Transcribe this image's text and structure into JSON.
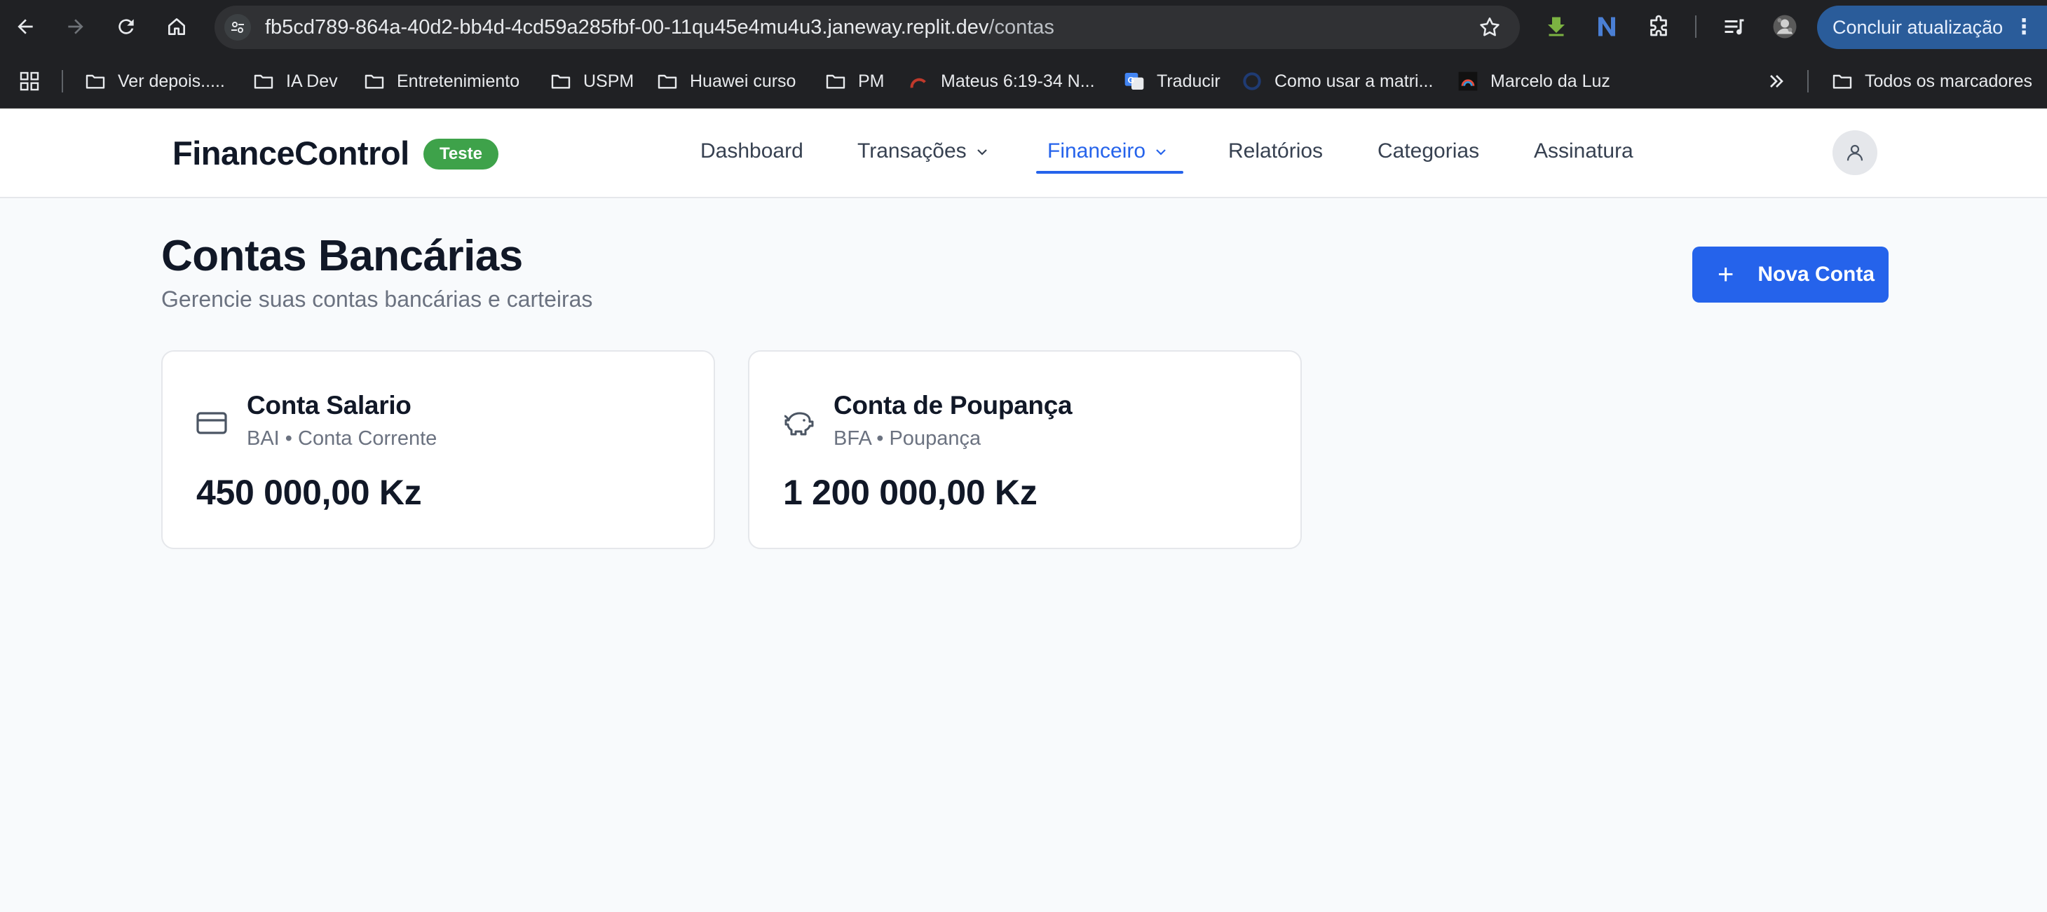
{
  "browser": {
    "url_host": "fb5cd789-864a-40d2-bb4d-4cd59a285fbf-00-11qu45e4mu4u3.janeway.replit.dev",
    "url_path": "/contas",
    "update_button": "Concluir atualização",
    "bookmarks": [
      {
        "label": "Ver depois.....",
        "icon": "folder-icon"
      },
      {
        "label": "IA Dev",
        "icon": "folder-icon"
      },
      {
        "label": "Entretenimiento",
        "icon": "folder-icon"
      },
      {
        "label": "USPM",
        "icon": "folder-icon"
      },
      {
        "label": "Huawei curso",
        "icon": "folder-icon"
      },
      {
        "label": "PM",
        "icon": "folder-icon"
      },
      {
        "label": "Mateus 6:19-34 N...",
        "icon": "site-icon"
      },
      {
        "label": "Traducir",
        "icon": "translate-icon"
      },
      {
        "label": "Como usar a matri...",
        "icon": "site-icon"
      },
      {
        "label": "Marcelo da Luz",
        "icon": "site-icon"
      }
    ],
    "all_bookmarks": "Todos os marcadores"
  },
  "header": {
    "brand": "FinanceControl",
    "badge": "Teste",
    "nav": {
      "dashboard": "Dashboard",
      "transacoes": "Transações",
      "financeiro": "Financeiro",
      "relatorios": "Relatórios",
      "categorias": "Categorias",
      "assinatura": "Assinatura"
    },
    "active_nav": "Financeiro"
  },
  "main": {
    "title": "Contas Bancárias",
    "subtitle": "Gerencie suas contas bancárias e carteiras",
    "new_button": "Nova Conta",
    "accounts": [
      {
        "name": "Conta Salario",
        "meta": "BAI • Conta Corrente",
        "balance": "450 000,00 Kz",
        "icon": "credit-card-icon"
      },
      {
        "name": "Conta de Poupança",
        "meta": "BFA • Poupança",
        "balance": "1 200 000,00 Kz",
        "icon": "piggy-bank-icon"
      }
    ]
  },
  "colors": {
    "accent": "#2563eb",
    "badge": "#3ea24a",
    "chrome": "#202124",
    "page_bg": "#f8fafc"
  }
}
